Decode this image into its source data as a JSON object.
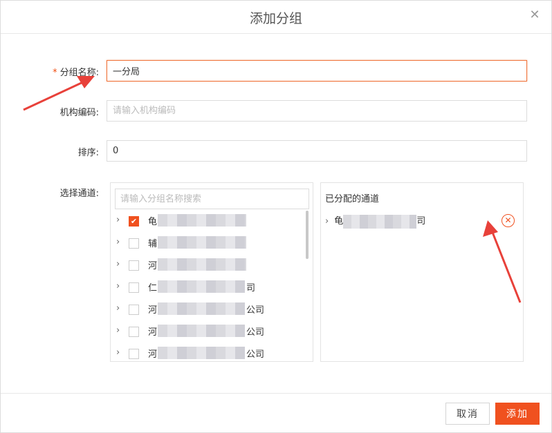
{
  "dialog": {
    "title": "添加分组",
    "close_icon": "close-icon"
  },
  "form": {
    "group_name": {
      "label": "分组名称:",
      "required_mark": "*",
      "value": "一分局"
    },
    "org_code": {
      "label": "机构编码:",
      "placeholder": "请输入机构编码"
    },
    "sort": {
      "label": "排序:",
      "value": "0"
    },
    "channel": {
      "label": "选择通道:"
    }
  },
  "left_panel": {
    "search_placeholder": "请输入分组名称搜索",
    "items": [
      {
        "prefix": "龟",
        "suffix": "",
        "checked": true
      },
      {
        "prefix": "辅",
        "suffix": "",
        "checked": false
      },
      {
        "prefix": "河",
        "suffix": "",
        "checked": false
      },
      {
        "prefix": "仁",
        "suffix": "司",
        "checked": false
      },
      {
        "prefix": "河",
        "suffix": "公司",
        "checked": false
      },
      {
        "prefix": "河",
        "suffix": "公司",
        "checked": false
      },
      {
        "prefix": "河",
        "suffix": "公司",
        "checked": false
      }
    ]
  },
  "right_panel": {
    "title": "已分配的通道",
    "item": {
      "prefix": "龟",
      "suffix": "司"
    }
  },
  "footer": {
    "cancel_label": "取消",
    "add_label": "添加"
  },
  "colors": {
    "accent": "#f0511f",
    "annotation_arrow": "#e8413a"
  }
}
